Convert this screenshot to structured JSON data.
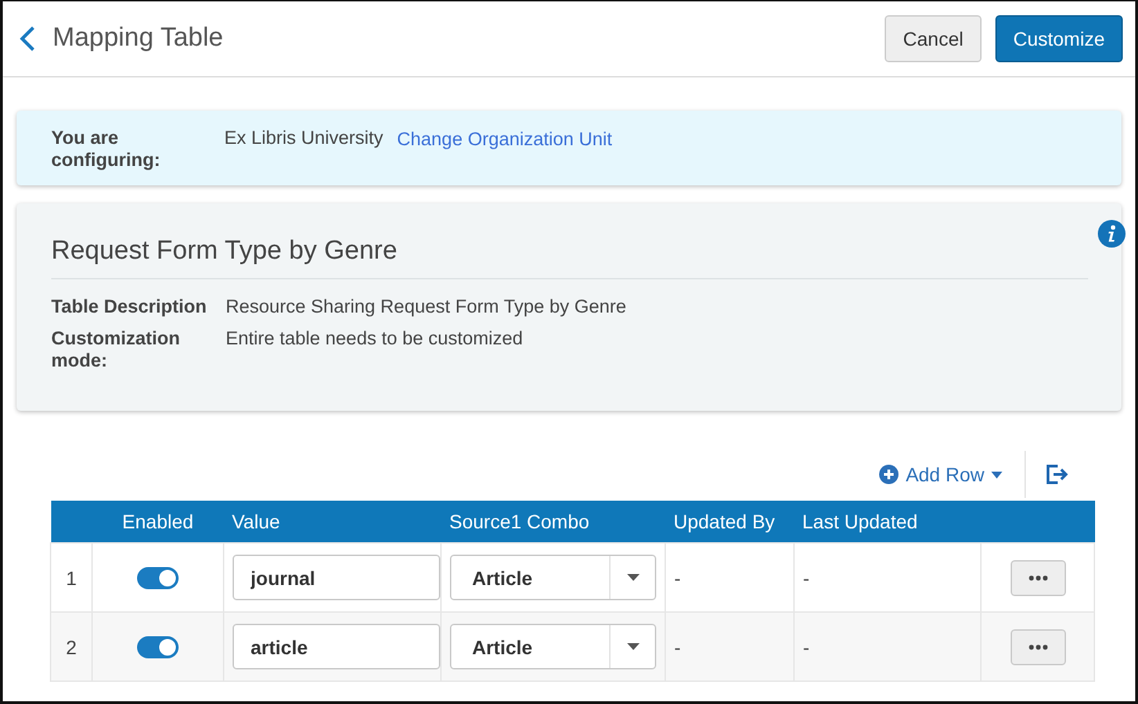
{
  "header": {
    "title": "Mapping Table",
    "buttons": [
      {
        "label": "Cancel",
        "kind": "secondary"
      },
      {
        "label": "Customize",
        "kind": "primary"
      }
    ]
  },
  "configuring": {
    "label": "You are configuring:",
    "value": "Ex Libris University",
    "link": "Change Organization Unit"
  },
  "details": {
    "title": "Request Form Type by Genre",
    "fields": [
      {
        "label": "Table Description",
        "value": "Resource Sharing Request Form Type by Genre"
      },
      {
        "label": "Customization mode:",
        "value": "Entire table needs to be customized"
      }
    ]
  },
  "toolbar": {
    "add_row": "Add Row"
  },
  "table": {
    "columns": [
      "Enabled",
      "Value",
      "Source1 Combo",
      "Updated By",
      "Last Updated"
    ],
    "rows": [
      {
        "number": "1",
        "enabled": true,
        "value": "journal",
        "source": "Article",
        "updated_by": "-",
        "last_updated": "-"
      },
      {
        "number": "2",
        "enabled": true,
        "value": "article",
        "source": "Article",
        "updated_by": "-",
        "last_updated": "-"
      }
    ]
  }
}
